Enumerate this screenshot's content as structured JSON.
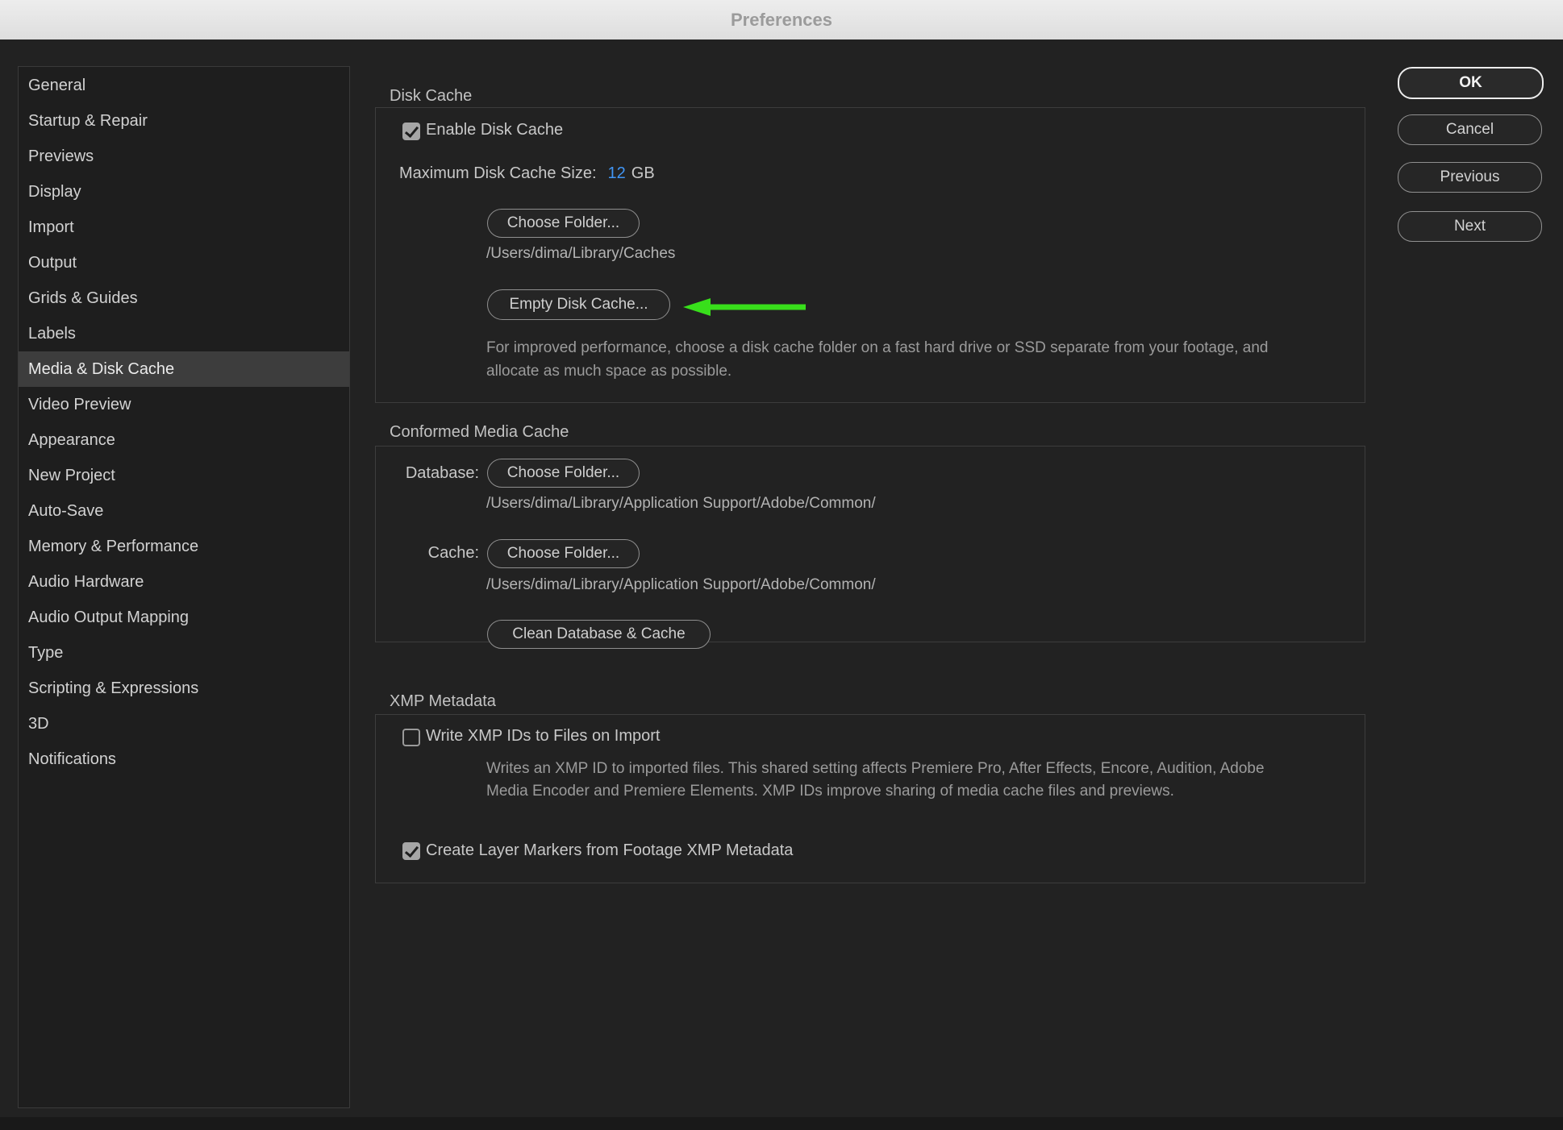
{
  "window": {
    "title": "Preferences"
  },
  "colors": {
    "accent_blue": "#4196f5",
    "arrow_green": "#38df1b"
  },
  "sidebar": {
    "items": [
      "General",
      "Startup & Repair",
      "Previews",
      "Display",
      "Import",
      "Output",
      "Grids & Guides",
      "Labels",
      "Media & Disk Cache",
      "Video Preview",
      "Appearance",
      "New Project",
      "Auto-Save",
      "Memory & Performance",
      "Audio Hardware",
      "Audio Output Mapping",
      "Type",
      "Scripting & Expressions",
      "3D",
      "Notifications"
    ],
    "selected": "Media & Disk Cache"
  },
  "disk_cache": {
    "title": "Disk Cache",
    "enable_label": "Enable Disk Cache",
    "enable_checked": true,
    "max_size_label": "Maximum Disk Cache Size:",
    "max_size_value": "12",
    "max_size_unit": "GB",
    "choose_folder_label": "Choose Folder...",
    "path": "/Users/dima/Library/Caches",
    "empty_button_label": "Empty Disk Cache...",
    "help_text": "For improved performance, choose a disk cache folder on a fast hard drive or SSD separate from your footage, and allocate as much space as possible."
  },
  "conformed": {
    "title": "Conformed Media Cache",
    "database_label": "Database:",
    "database_choose_label": "Choose Folder...",
    "database_path": "/Users/dima/Library/Application Support/Adobe/Common/",
    "cache_label": "Cache:",
    "cache_choose_label": "Choose Folder...",
    "cache_path": "/Users/dima/Library/Application Support/Adobe/Common/",
    "clean_button_label": "Clean Database & Cache"
  },
  "xmp": {
    "title": "XMP Metadata",
    "write_label": "Write XMP IDs to Files on Import",
    "write_checked": false,
    "description": "Writes an XMP ID to imported files. This shared setting affects Premiere Pro, After Effects, Encore, Audition, Adobe Media Encoder and Premiere Elements. XMP IDs improve sharing of media cache files and previews.",
    "markers_label": "Create Layer Markers from Footage XMP Metadata",
    "markers_checked": true
  },
  "actions": {
    "ok": "OK",
    "cancel": "Cancel",
    "previous": "Previous",
    "next": "Next"
  }
}
